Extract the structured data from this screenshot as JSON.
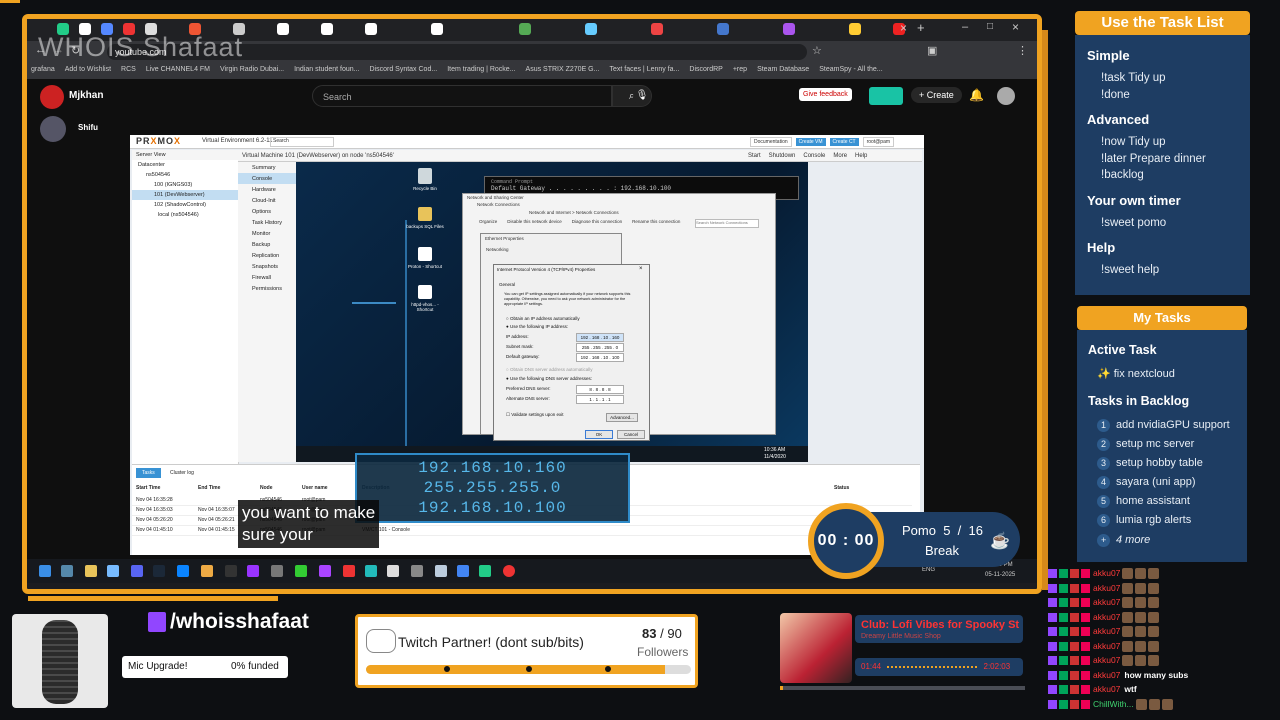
{
  "watermark": "WHOIS Shafaat",
  "browser": {
    "url": "youtube.com",
    "bookmarks": [
      "grafana",
      "Add to Wishlist",
      "RCS",
      "Live CHANNEL4 FM",
      "Virgin Radio Dubai...",
      "Indian student foun...",
      "Discord Syntax Cod...",
      "Item trading | Rocke...",
      "Asus STRIX Z270E G...",
      "Text faces | Lenny fa...",
      "DiscordRP",
      "+rep",
      "Steam Database",
      "SteamSpy - All the..."
    ]
  },
  "youtube": {
    "channel": "Mjkhan",
    "viewer": "Shifu",
    "search_placeholder": "Search",
    "feedback": "Give feedback",
    "create": "Create"
  },
  "proxmox": {
    "logo_a": "PR",
    "logo_x": "X",
    "logo_b": "MO",
    "logo_c": "X",
    "version": "Virtual Environment 6.2-11",
    "search": "Search",
    "header_buttons": [
      "Documentation",
      "Create VM",
      "Create CT",
      "root@pam"
    ],
    "vm_title": "Virtual Machine 101 (DevWebserver) on node 'ns504546'",
    "vm_buttons": [
      "Start",
      "Shutdown",
      "Console",
      "More",
      "Help"
    ],
    "server_view": "Server View",
    "tree": [
      "Datacenter",
      "ns504546",
      "100 (IGNGS03)",
      "101 (DevWebserver)",
      "102 (ShadowControl)",
      "local (ns504546)"
    ],
    "menu": [
      "Summary",
      "Console",
      "Hardware",
      "Cloud-Init",
      "Options",
      "Task History",
      "Monitor",
      "Backup",
      "Replication",
      "Snapshots",
      "Firewall",
      "Permissions"
    ],
    "tasks_tabs": [
      "Tasks",
      "Cluster log"
    ],
    "task_cols": [
      "Start Time",
      "End Time",
      "Node",
      "User name",
      "Description",
      "Status"
    ],
    "task_rows": [
      [
        "Nov 04 16:35:28",
        "",
        "ns504546",
        "root@pam",
        "",
        ""
      ],
      [
        "Nov 04 16:35:03",
        "Nov 04 16:35:07",
        "ns504546",
        "root@pam",
        "",
        ""
      ],
      [
        "Nov 04 05:26:20",
        "Nov 04 05:26:21",
        "ns504546",
        "root@pam",
        "",
        ""
      ],
      [
        "Nov 04 01:45:10",
        "Nov 04 01:45:15",
        "ns504546",
        "root@pam",
        "VM/CT 101 - Console",
        ""
      ]
    ]
  },
  "windows": {
    "cmd_title": "Command Prompt",
    "cmd_line": "Default Gateway . . . . . . . . . : 192.168.10.100",
    "netconn_title": "Network and Sharing Center",
    "netconn_sub": "Network Connections",
    "netconn_path": "Network and Internet  >  Network Connections",
    "netconn_search": "Search Network Connections",
    "toolbar": [
      "Organize",
      "Disable this network device",
      "Diagnose this connection",
      "Rename this connection"
    ],
    "eth_title": "Ethernet Properties",
    "eth_tab": "Networking",
    "ipv4_title": "Internet Protocol Version 4 (TCP/IPv4) Properties",
    "ipv4_tab": "General",
    "ipv4_desc": "You can get IP settings assigned automatically if your network supports this capability. Otherwise, you need to ask your network administrator for the appropriate IP settings.",
    "ipv4_auto": "Obtain an IP address automatically",
    "ipv4_manual": "Use the following IP address:",
    "ip_label": "IP address:",
    "ip_value": "192 . 168 . 10 . 160",
    "mask_label": "Subnet mask:",
    "mask_value": "255 . 255 . 255 . 0",
    "gw_label": "Default gateway:",
    "gw_value": "192 . 168 . 10 . 100",
    "dns_auto": "Obtain DNS server address automatically",
    "dns_manual": "Use the following DNS server addresses:",
    "dns1_label": "Preferred DNS server:",
    "dns1_value": "8 . 8 . 8 . 8",
    "dns2_label": "Alternate DNS server:",
    "dns2_value": "1 . 1 . 1 . 1",
    "validate": "Validate settings upon exit",
    "advanced": "Advanced...",
    "ok": "OK",
    "cancel": "Cancel",
    "recycle": "Recycle Bin",
    "desk_icons": [
      "backups SQL Files",
      "Proton - Shortcut",
      "httpd-vhos... - Shortcut"
    ],
    "clock": "10:36 AM",
    "date": "11/4/2020"
  },
  "callout": [
    "192.168.10.160",
    "255.255.255.0",
    "192.168.10.100"
  ],
  "caption": [
    "you want to make",
    "sure your"
  ],
  "host_clock": "02:03 PM",
  "host_date": "05-11-2025",
  "host_lang": "ENG",
  "commands": {
    "header": "Use the Task List",
    "sections": [
      {
        "title": "Simple",
        "items": [
          "!task Tidy up",
          "!done"
        ]
      },
      {
        "title": "Advanced",
        "items": [
          "!now Tidy up",
          "!later Prepare dinner",
          "!backlog"
        ]
      },
      {
        "title": "Your own timer",
        "items": [
          "!sweet pomo"
        ]
      },
      {
        "title": "Help",
        "items": [
          "!sweet help"
        ]
      }
    ]
  },
  "tasks": {
    "header": "My Tasks",
    "active_title": "Active Task",
    "active": "✨ fix nextcloud",
    "backlog_title": "Tasks in Backlog",
    "backlog": [
      "add nvidiaGPU support",
      "setup mc server",
      "setup hobby table",
      "sayara (uni app)",
      "home assistant",
      "lumia rgb alerts"
    ],
    "more_symbol": "+",
    "more": "4 more"
  },
  "pomo": {
    "time": "00 : 00",
    "label": "Pomo",
    "current": "5",
    "sep": "/",
    "total": "16",
    "state": "Break"
  },
  "stream": {
    "twitch_handle": "/whoisshafaat",
    "mic_label": "Mic Upgrade!",
    "mic_funded": "0% funded",
    "goal_title": "Twitch Partner! (dont sub/bits)",
    "followers_current": "83",
    "followers_sep": "/",
    "followers_goal": "90",
    "followers_label": "Followers",
    "followers_progress": 0.92
  },
  "music": {
    "title": "Club: Lofi Vibes for Spooky St",
    "artist": "Dreamy Little Music Shop",
    "elapsed": "01:44",
    "duration": "2:02:03",
    "progress": 0.014
  },
  "chat": [
    {
      "user": "akku07",
      "msg": ""
    },
    {
      "user": "akku07",
      "msg": ""
    },
    {
      "user": "akku07",
      "msg": ""
    },
    {
      "user": "akku07",
      "msg": ""
    },
    {
      "user": "akku07",
      "msg": ""
    },
    {
      "user": "akku07",
      "msg": ""
    },
    {
      "user": "akku07",
      "msg": ""
    },
    {
      "user": "akku07",
      "msg": "how many subs"
    },
    {
      "user": "akku07",
      "msg": "wtf"
    },
    {
      "user": "ChillWith...",
      "msg": ""
    }
  ],
  "colors": {
    "accent": "#f0a321",
    "panel": "#1e3d63",
    "callout": "#57b8ea"
  }
}
